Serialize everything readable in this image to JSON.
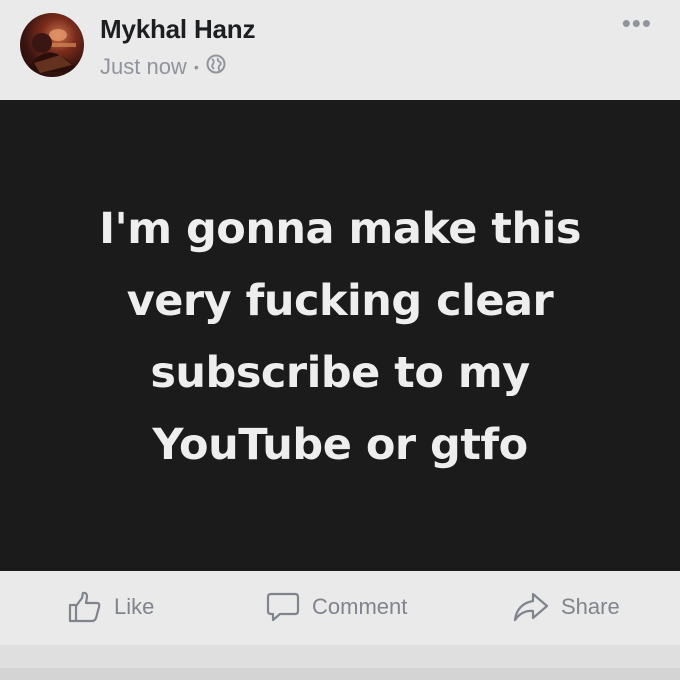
{
  "post": {
    "author": "Mykhal Hanz",
    "timestamp": "Just now",
    "separator": "•",
    "privacy_icon": "globe-icon",
    "more_icon": "more-options-icon",
    "more_label": "•••",
    "status_lines": [
      "I'm gonna make this",
      "very fucking clear",
      "subscribe to my",
      "YouTube or gtfo"
    ],
    "background_color": "#1b1b1b",
    "text_color": "#eeeeee"
  },
  "actions": {
    "like": {
      "label": "Like",
      "icon": "thumbs-up-icon"
    },
    "comment": {
      "label": "Comment",
      "icon": "comment-icon"
    },
    "share": {
      "label": "Share",
      "icon": "share-arrow-icon"
    }
  }
}
